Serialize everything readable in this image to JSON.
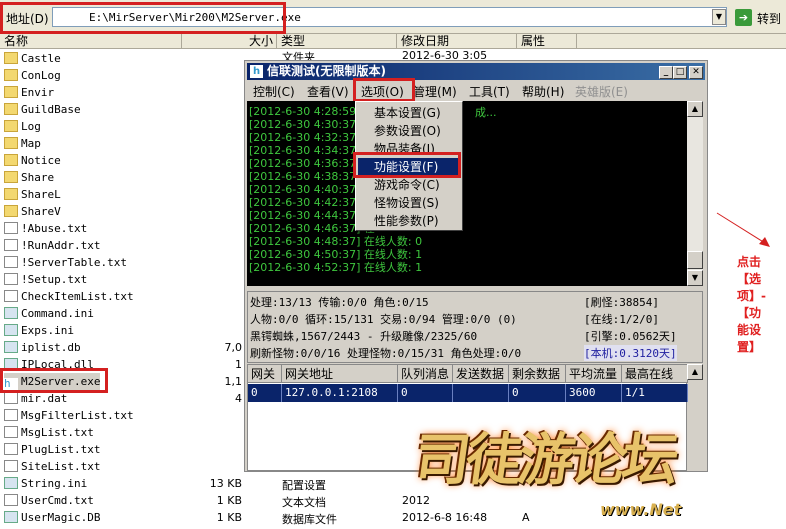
{
  "address": {
    "label": "地址(D)",
    "value": "E:\\MirServer\\Mir200\\M2Server.exe",
    "go": "转到"
  },
  "columns": [
    "名称",
    "大小",
    "类型",
    "修改日期",
    "属性"
  ],
  "files": [
    {
      "name": "Castle",
      "kind": "folder"
    },
    {
      "name": "ConLog",
      "kind": "folder"
    },
    {
      "name": "Envir",
      "kind": "folder"
    },
    {
      "name": "GuildBase",
      "kind": "folder"
    },
    {
      "name": "Log",
      "kind": "folder"
    },
    {
      "name": "Map",
      "kind": "folder"
    },
    {
      "name": "Notice",
      "kind": "folder"
    },
    {
      "name": "Share",
      "kind": "folder"
    },
    {
      "name": "ShareL",
      "kind": "folder"
    },
    {
      "name": "ShareV",
      "kind": "folder"
    },
    {
      "name": "!Abuse.txt",
      "kind": "file"
    },
    {
      "name": "!RunAddr.txt",
      "kind": "file"
    },
    {
      "name": "!ServerTable.txt",
      "kind": "file"
    },
    {
      "name": "!Setup.txt",
      "kind": "file"
    },
    {
      "name": "CheckItemList.txt",
      "kind": "file"
    },
    {
      "name": "Command.ini",
      "kind": "cfg"
    },
    {
      "name": "Exps.ini",
      "kind": "cfg"
    },
    {
      "name": "iplist.db",
      "kind": "cfg",
      "size": "7,0"
    },
    {
      "name": "IPLocal.dll",
      "kind": "cfg",
      "size": "1"
    },
    {
      "name": "M2Server.exe",
      "kind": "exe",
      "size": "1,1"
    },
    {
      "name": "mir.dat",
      "kind": "file",
      "size": "4"
    },
    {
      "name": "MsgFilterList.txt",
      "kind": "file"
    },
    {
      "name": "MsgList.txt",
      "kind": "file"
    },
    {
      "name": "PlugList.txt",
      "kind": "file"
    },
    {
      "name": "SiteList.txt",
      "kind": "file"
    },
    {
      "name": "String.ini",
      "kind": "cfg",
      "size": "13 KB",
      "type": "配置设置"
    },
    {
      "name": "UserCmd.txt",
      "kind": "file",
      "size": "1 KB",
      "type": "文本文档",
      "date": "2012"
    },
    {
      "name": "UserMagic.DB",
      "kind": "cfg",
      "size": "1 KB",
      "type": "数据库文件",
      "date": "2012-6-8 16:48",
      "attr": "A"
    }
  ],
  "first_row": {
    "type": "文件夹",
    "date": "2012-6-30 3:05"
  },
  "window": {
    "title": "信联测试(无限制版本)",
    "menu": [
      "控制(C)",
      "查看(V)",
      "选项(O)",
      "管理(M)",
      "工具(T)",
      "帮助(H)",
      "英雄版(E)"
    ],
    "dropdown": [
      "基本设置(G)",
      "参数设置(O)",
      "物品装备(I)",
      "功能设置(F)",
      "游戏命令(C)",
      "怪物设置(S)",
      "性能参数(P)"
    ],
    "log": [
      "[2012-6-30 4:28:59] 重",
      "[2012-6-30 4:30:37] 在",
      "[2012-6-30 4:32:37] 在",
      "[2012-6-30 4:34:37] 在",
      "[2012-6-30 4:36:37] 在",
      "[2012-6-30 4:38:37] 在",
      "[2012-6-30 4:40:37] 在",
      "[2012-6-30 4:42:37] 在",
      "[2012-6-30 4:44:37] 在",
      "[2012-6-30 4:46:37] 在",
      "[2012-6-30 4:48:37] 在线人数: 0",
      "[2012-6-30 4:50:37] 在线人数: 1",
      "[2012-6-30 4:52:37] 在线人数: 1"
    ],
    "log_tail": "成...",
    "status_left": [
      "处理:13/13 传输:0/0 角色:0/15",
      "人物:0/0 循环:15/131 交易:0/94 管理:0/0 (0)",
      "黑锷蜘蛛,1567/2443 - 升级雕像/2325/60",
      "刷新怪物:0/0/16 处理怪物:0/15/31 角色处理:0/0"
    ],
    "status_right": [
      "[刷怪:38854]",
      "[在线:1/2/0]",
      "[引擎:0.0562天]",
      "[本机:0.3120天]"
    ],
    "grid_headers": [
      "网关",
      "网关地址",
      "队列消息",
      "发送数据",
      "剩余数据",
      "平均流量",
      "最高在线"
    ],
    "grid_row": [
      "0",
      "127.0.0.1:2108",
      "0",
      "",
      "0",
      "3600",
      "1/1"
    ]
  },
  "annotation": "点击【选项】-【功能设置】",
  "logo": {
    "text": "司徒游论坛",
    "sub": "www.Net"
  },
  "colors": {
    "highlight": "#d42020",
    "console_text": "#3ec63e",
    "selection": "#0a246a"
  }
}
